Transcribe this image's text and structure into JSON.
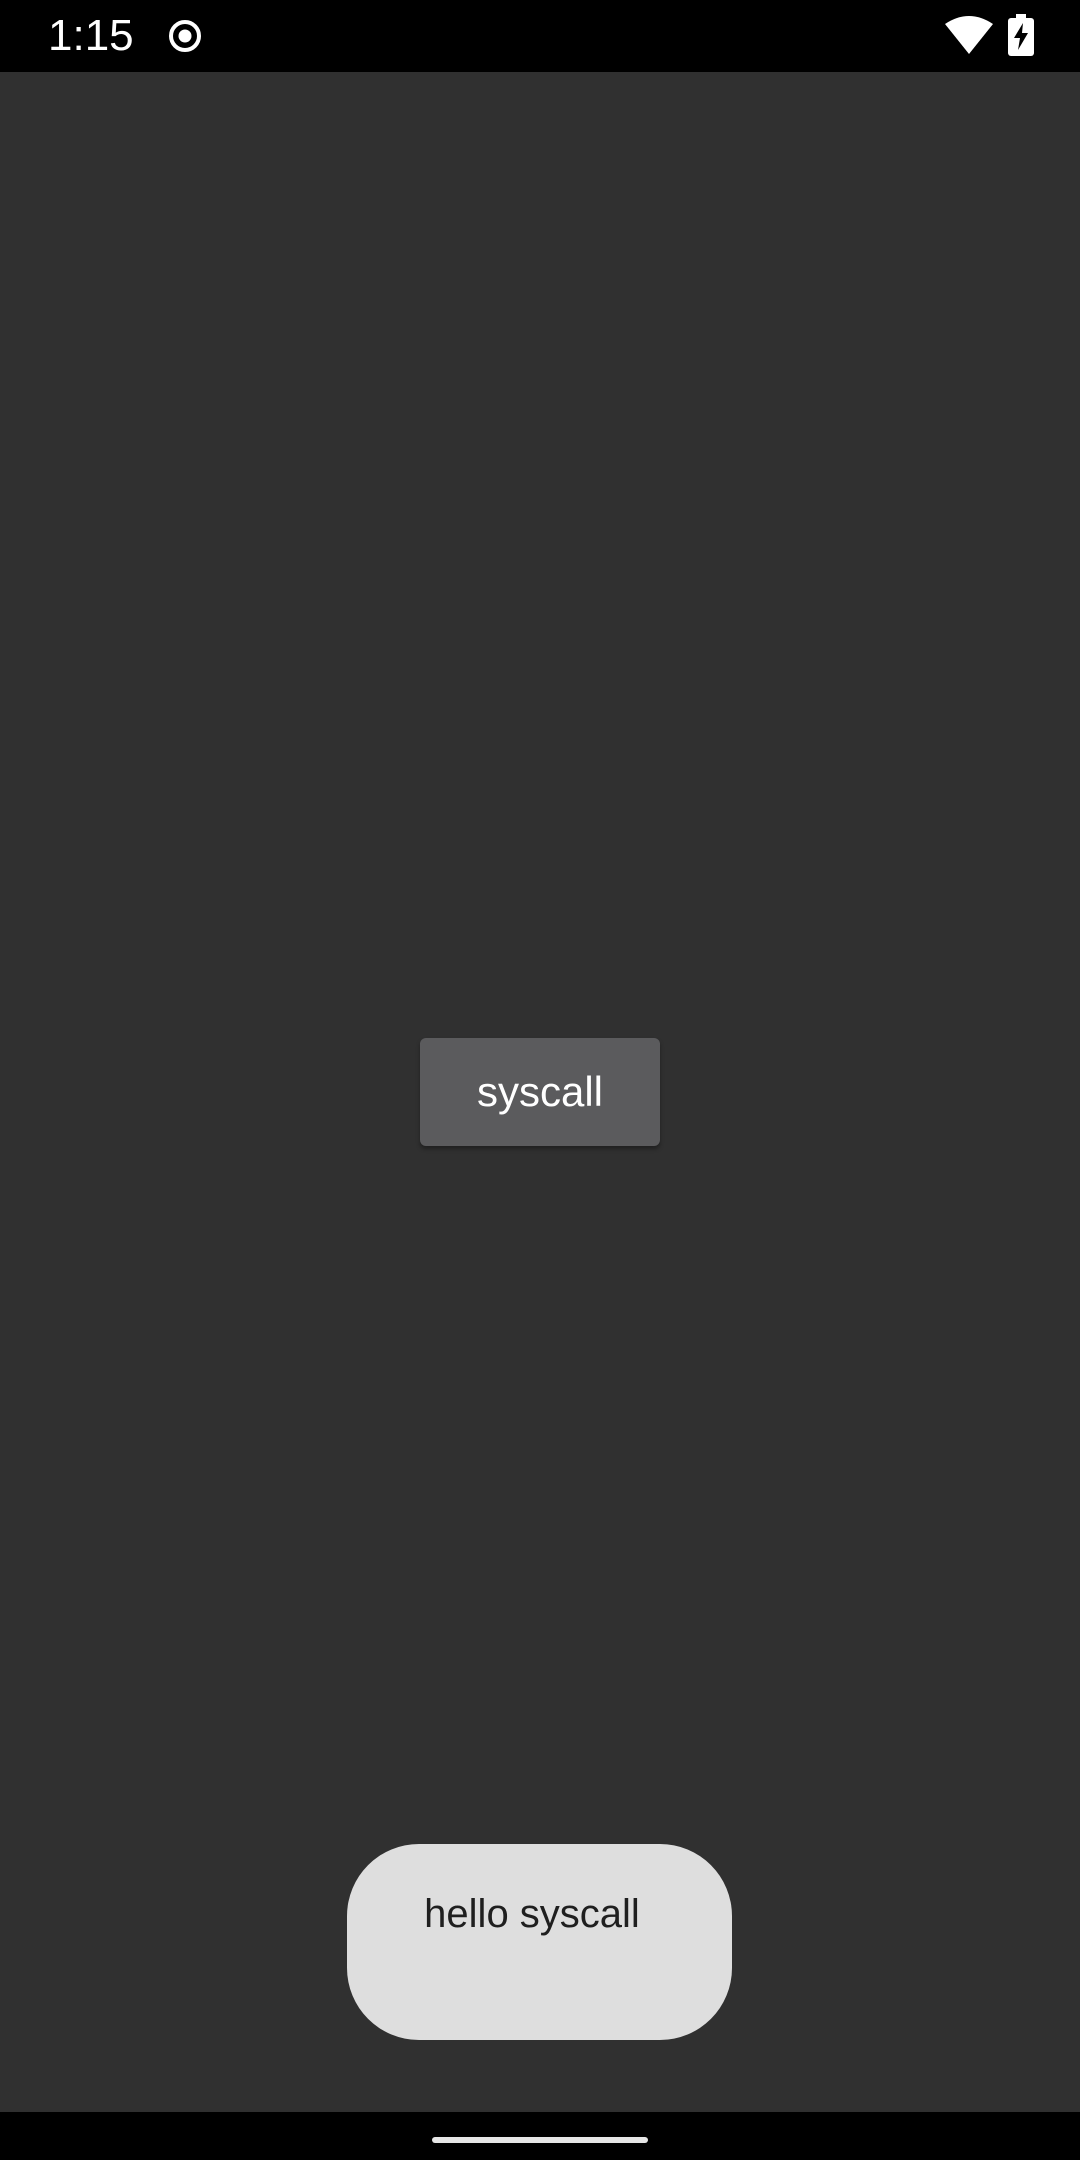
{
  "status_bar": {
    "time": "1:15",
    "icons": [
      "record-icon",
      "wifi-icon",
      "battery-charging-icon"
    ]
  },
  "main": {
    "button_label": "syscall"
  },
  "toast": {
    "message": "hello syscall"
  },
  "colors": {
    "background": "#303030",
    "button": "#5b5b5d",
    "toast": "#dedede",
    "bars": "#000000"
  }
}
